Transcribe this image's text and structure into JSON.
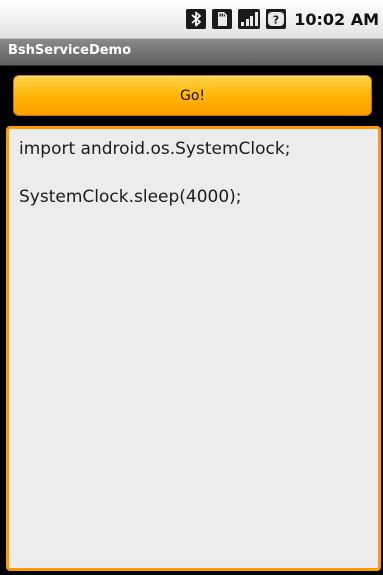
{
  "status_bar": {
    "icons": [
      "bluetooth-icon",
      "sd-card-icon",
      "signal-icon",
      "unknown-app-icon"
    ],
    "time": "10:02 AM"
  },
  "app": {
    "title": "BshServiceDemo"
  },
  "go_button": {
    "label": "Go!",
    "color": "#ffb300"
  },
  "editor": {
    "lines": [
      "import android.os.SystemClock;",
      "SystemClock.sleep(4000);"
    ],
    "focus_color": "#ff9a00"
  }
}
